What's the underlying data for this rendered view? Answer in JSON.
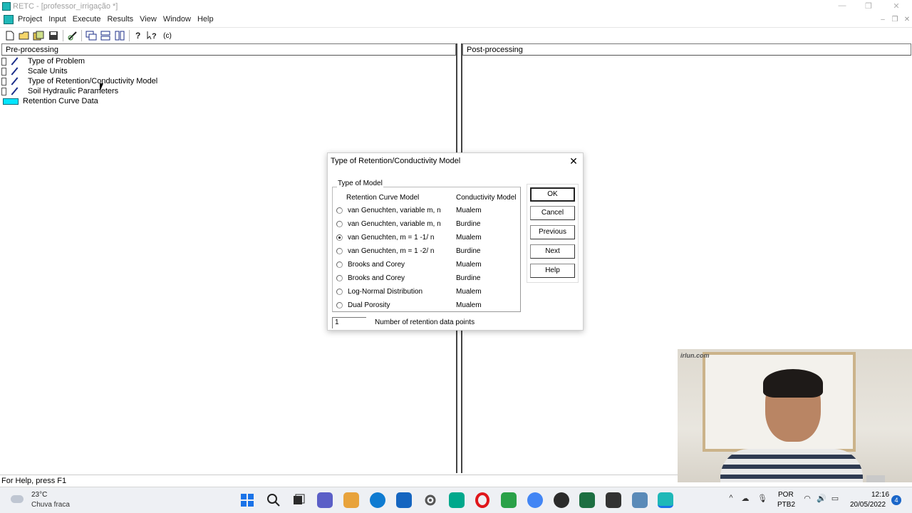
{
  "window": {
    "title": "RETC - [professor_irrigação *]"
  },
  "menu": [
    "Project",
    "Input",
    "Execute",
    "Results",
    "View",
    "Window",
    "Help"
  ],
  "toolbar_icons": [
    "new-file-icon",
    "open-folder-icon",
    "copy-icon",
    "save-icon",
    "edit-icon",
    "cascade-windows-icon",
    "tile-horizontal-icon",
    "tile-vertical-icon",
    "help-icon",
    "context-help-icon",
    "about-icon"
  ],
  "toolbar_about_label": "(c)",
  "pre": {
    "header": "Pre-processing",
    "items": [
      {
        "label": "Type of Problem"
      },
      {
        "label": "Scale Units"
      },
      {
        "label": "Type of Retention/Conductivity Model"
      },
      {
        "label": "Soil Hydraulic Parameters"
      },
      {
        "label": "Retention Curve Data"
      }
    ]
  },
  "post": {
    "header": "Post-processing"
  },
  "status": "For Help, press F1",
  "dialog": {
    "title": "Type of Retention/Conductivity Model",
    "group_label": "Type of Model",
    "col_retention": "Retention Curve Model",
    "col_conductivity": "Conductivity Model",
    "selected_index": 2,
    "options": [
      {
        "retention": "van Genuchten, variable m, n",
        "conductivity": "Mualem"
      },
      {
        "retention": "van Genuchten, variable m, n",
        "conductivity": "Burdine"
      },
      {
        "retention": "van Genuchten, m = 1 -1/ n",
        "conductivity": "Mualem"
      },
      {
        "retention": "van Genuchten, m = 1 -2/ n",
        "conductivity": "Burdine"
      },
      {
        "retention": "Brooks and Corey",
        "conductivity": "Mualem"
      },
      {
        "retention": "Brooks and Corey",
        "conductivity": "Burdine"
      },
      {
        "retention": "Log-Normal Distribution",
        "conductivity": "Mualem"
      },
      {
        "retention": "Dual Porosity",
        "conductivity": "Mualem"
      }
    ],
    "buttons": {
      "ok": "OK",
      "cancel": "Cancel",
      "previous": "Previous",
      "next": "Next",
      "help": "Help"
    },
    "num_points_value": "1",
    "num_points_label": "Number of retention data points"
  },
  "webcam": {
    "watermark": "irlun.com"
  },
  "taskbar": {
    "temperature": "23°C",
    "condition": "Chuva fraca",
    "lang1": "POR",
    "lang2": "PTB2",
    "time": "12:16",
    "date": "20/05/2022",
    "notifications": "4",
    "app_colors": [
      "#1a73e8",
      "#222222",
      "#2b2b2b",
      "#5b5fc7",
      "#e8a33c",
      "#0f7bd1",
      "#1565c0",
      "#6b6b6b",
      "#00a88c",
      "#e0161b",
      "#2aa148",
      "#4285f4",
      "#2b2b2b",
      "#1d6f42",
      "#333333",
      "#5a8ab8",
      "#1fb8b8"
    ]
  }
}
